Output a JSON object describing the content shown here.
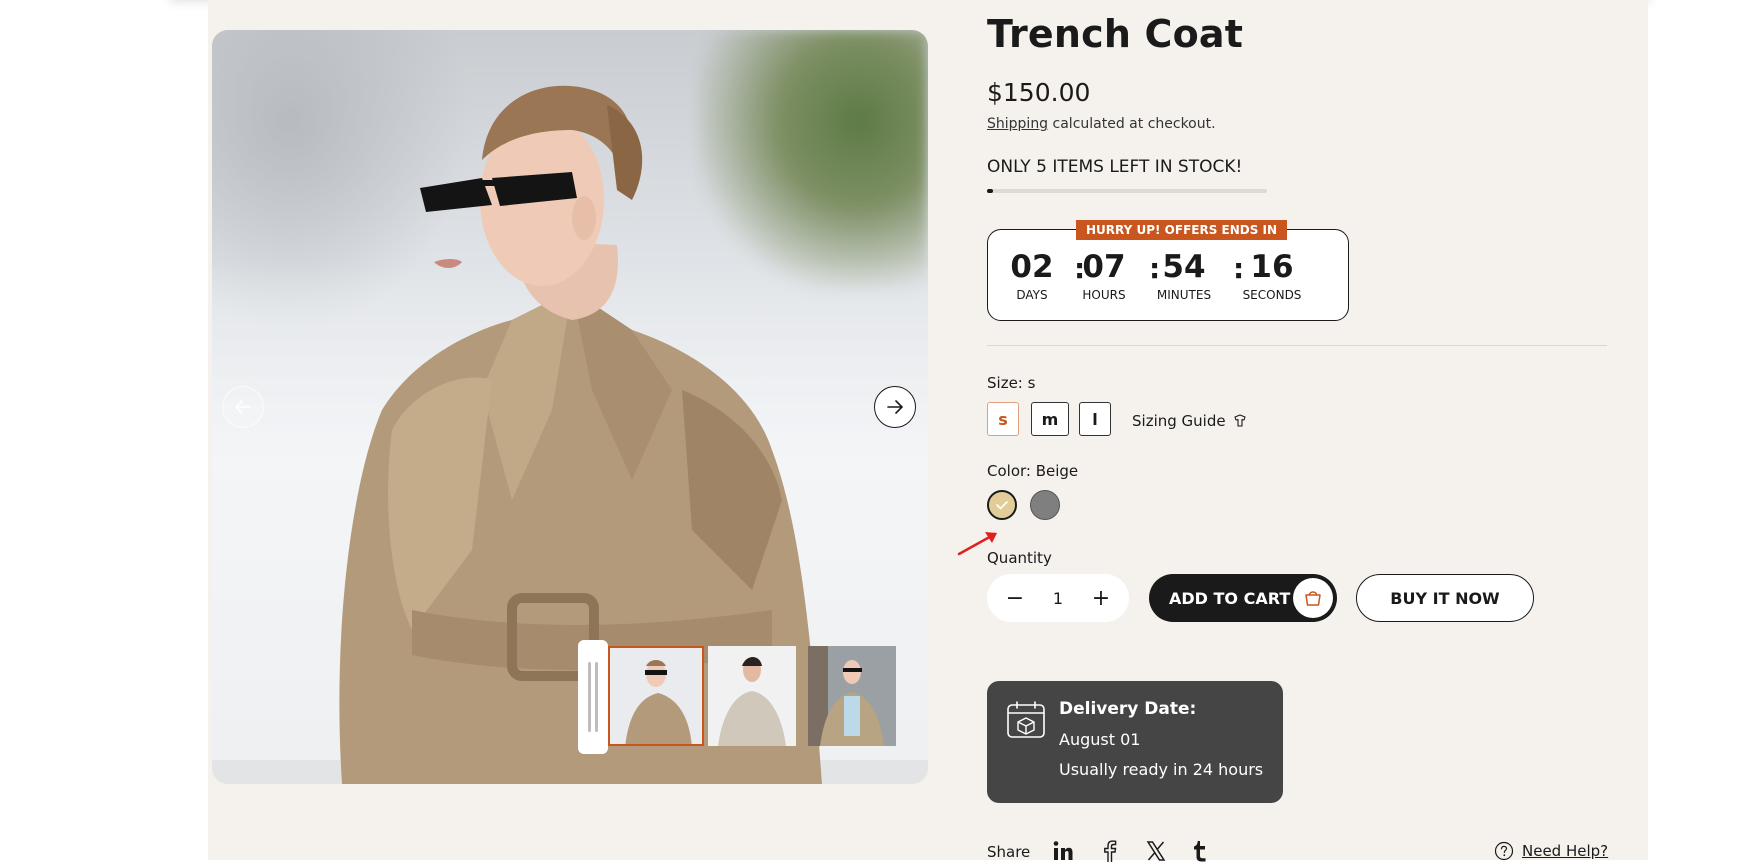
{
  "product": {
    "title": "Trench Coat",
    "price": "$150.00",
    "shipping_link": "Shipping",
    "shipping_rest": "calculated at checkout.",
    "stock_text": "ONLY 5 ITEMS LEFT IN STOCK!",
    "stock_fraction": 0.02
  },
  "countdown": {
    "banner": "HURRY UP! OFFERS ENDS IN",
    "units": [
      {
        "value": "02",
        "label": "DAYS"
      },
      {
        "value": "07",
        "label": "HOURS"
      },
      {
        "value": "54",
        "label": "MINUTES"
      },
      {
        "value": "16",
        "label": "SECONDS"
      }
    ],
    "separator": ":"
  },
  "size": {
    "label": "Size: s",
    "options": [
      "s",
      "m",
      "l"
    ],
    "selected": "s",
    "guide": "Sizing Guide"
  },
  "color": {
    "label": "Color: Beige",
    "options": [
      {
        "name": "Beige",
        "hex": "#e2cd98"
      },
      {
        "name": "Gray",
        "hex": "#7f7f7f"
      }
    ]
  },
  "quantity": {
    "label": "Quantity",
    "value": "1",
    "minus": "−",
    "plus": "+"
  },
  "actions": {
    "add_to_cart": "ADD TO CART",
    "buy_now": "BUY IT NOW"
  },
  "delivery": {
    "title": "Delivery Date:",
    "date": "August 01",
    "note": "Usually ready in 24 hours"
  },
  "share": {
    "label": "Share",
    "networks": [
      "linkedin-icon",
      "facebook-icon",
      "x-icon",
      "tumblr-icon"
    ],
    "help": "Need Help?"
  },
  "colors": {
    "accent": "#c8561e",
    "panel": "#f5f2ee",
    "dark": "#1a1a1a"
  }
}
